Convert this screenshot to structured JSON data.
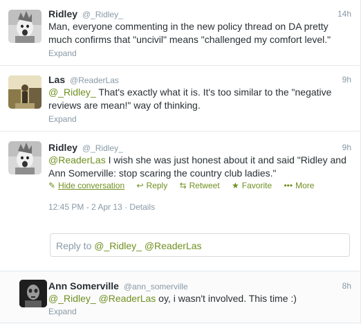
{
  "tweets": [
    {
      "name": "Ridley",
      "handle": "@_Ridley_",
      "time": "14h",
      "text": "Man, everyone commenting in the new policy thread on DA pretty much confirms that \"uncivil\" means \"challenged my comfort level.\"",
      "expand": "Expand"
    },
    {
      "name": "Las",
      "handle": "@ReaderLas",
      "time": "9h",
      "mention": "@_Ridley_",
      "text": " That's exactly what it is. It's too similar to the \"negative reviews are mean!\" way of thinking.",
      "expand": "Expand"
    },
    {
      "name": "Ridley",
      "handle": "@_Ridley_",
      "time": "9h",
      "mention": "@ReaderLas",
      "text": " I wish she was just honest about it and said \"Ridley and Ann Somerville: stop scaring the country club ladies.\"",
      "actions": {
        "hide": "Hide conversation",
        "reply": "Reply",
        "retweet": "Retweet",
        "favorite": "Favorite",
        "more": "More"
      },
      "timestamp": "12:45 PM - 2 Apr 13",
      "details": "Details"
    },
    {
      "name": "Ann Somerville",
      "handle": "@ann_somerville",
      "time": "8h",
      "mention": "@_Ridley_ @ReaderLas",
      "text": " oy, i wasn't involved. This time :)",
      "expand": "Expand"
    }
  ],
  "reply_box": {
    "prefix": "Reply to ",
    "mentions": "@_Ridley_ @ReaderLas"
  },
  "colors": {
    "link": "#6f8f1f",
    "muted": "#8899a6"
  }
}
